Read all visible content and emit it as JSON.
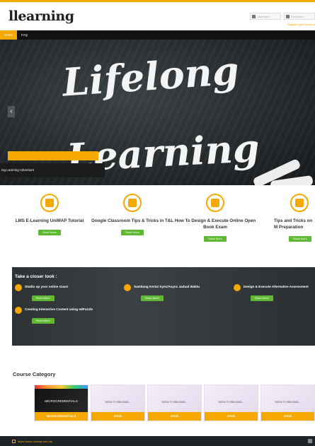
{
  "header": {
    "logo": "llearning",
    "username_placeholder": "Username",
    "password_placeholder": "Password",
    "register_link": "Register your account"
  },
  "nav": {
    "tabs": [
      {
        "label": "Home",
        "active": true
      },
      {
        "label": "FAQ",
        "active": false
      }
    ]
  },
  "hero": {
    "line1": "Lifelong",
    "line2": "Learning",
    "caption": "ing Learning Adventure",
    "prev_arrow": "‹"
  },
  "features": [
    {
      "title": "LMS E-Learning UniMAP Tutorial",
      "button": "Read More",
      "icon": "document-icon"
    },
    {
      "title": "Google Classroom Tips & Tricks in T&L",
      "button": "Read More",
      "icon": "clipboard-icon"
    },
    {
      "title": "How To Design & Execute Online Open Book Exam",
      "button": "Read More",
      "icon": "sliders-icon"
    },
    {
      "title": "Tips and Tricks on M Preparation",
      "button": "Read More",
      "icon": "flag-icon"
    }
  ],
  "closer": {
    "heading": "Take a closer look :",
    "items": [
      {
        "text": "Studio up your online class!",
        "button": "Read More"
      },
      {
        "text": "Sambang Kertai Sync/Async Jadual Waktu",
        "button": "Read More"
      },
      {
        "text": "Design & Execute Alternative Assessment",
        "button": "Read More"
      },
      {
        "text": "Creating Interactive Content using edPuzzle",
        "button": "Read More"
      }
    ]
  },
  "course_category": {
    "heading": "Course Category",
    "cards": [
      {
        "image_text": "MICROCREDENTIALS",
        "label": "MICROCREDENTIALS",
        "dark": true
      },
      {
        "image_text": "SOON TO RELEASE...",
        "label": "SOON",
        "dark": false
      },
      {
        "image_text": "SOON TO RELEASE...",
        "label": "SOON",
        "dark": false
      },
      {
        "image_text": "SOON TO RELEASE...",
        "label": "SOON",
        "dark": false
      },
      {
        "image_text": "SOON TO RELEASE...",
        "label": "SOON",
        "dark": false
      }
    ]
  },
  "footer": {
    "url": "https://www.unimap.edu.my"
  },
  "colors": {
    "accent": "#f5a800",
    "button_green": "#5fb832",
    "nav_bg": "#111111"
  }
}
